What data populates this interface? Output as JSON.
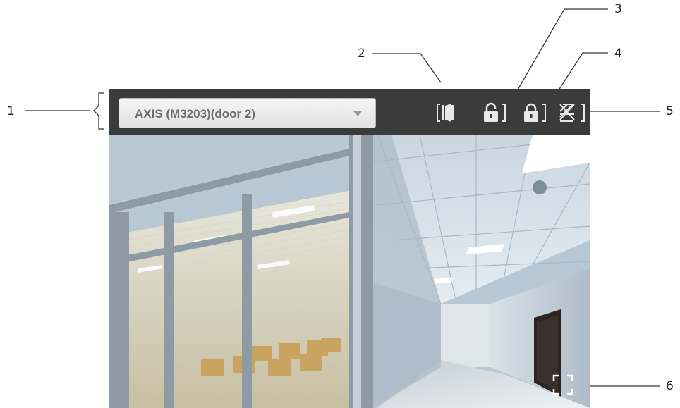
{
  "callouts": {
    "n1": "1",
    "n2": "2",
    "n3": "3",
    "n4": "4",
    "n5": "5",
    "n6": "6"
  },
  "toolbar": {
    "door_select": {
      "selected": "AXIS (M3203)(door 2)"
    },
    "buttons": [
      {
        "icon": "door-access-icon"
      },
      {
        "icon": "unlock-icon"
      },
      {
        "icon": "lock-icon"
      },
      {
        "icon": "door-disabled-icon"
      }
    ]
  },
  "colors": {
    "toolbar_bg": "#3b3b3b",
    "icon": "#e8e8e8",
    "dropdown_text": "#6d6d6d"
  }
}
